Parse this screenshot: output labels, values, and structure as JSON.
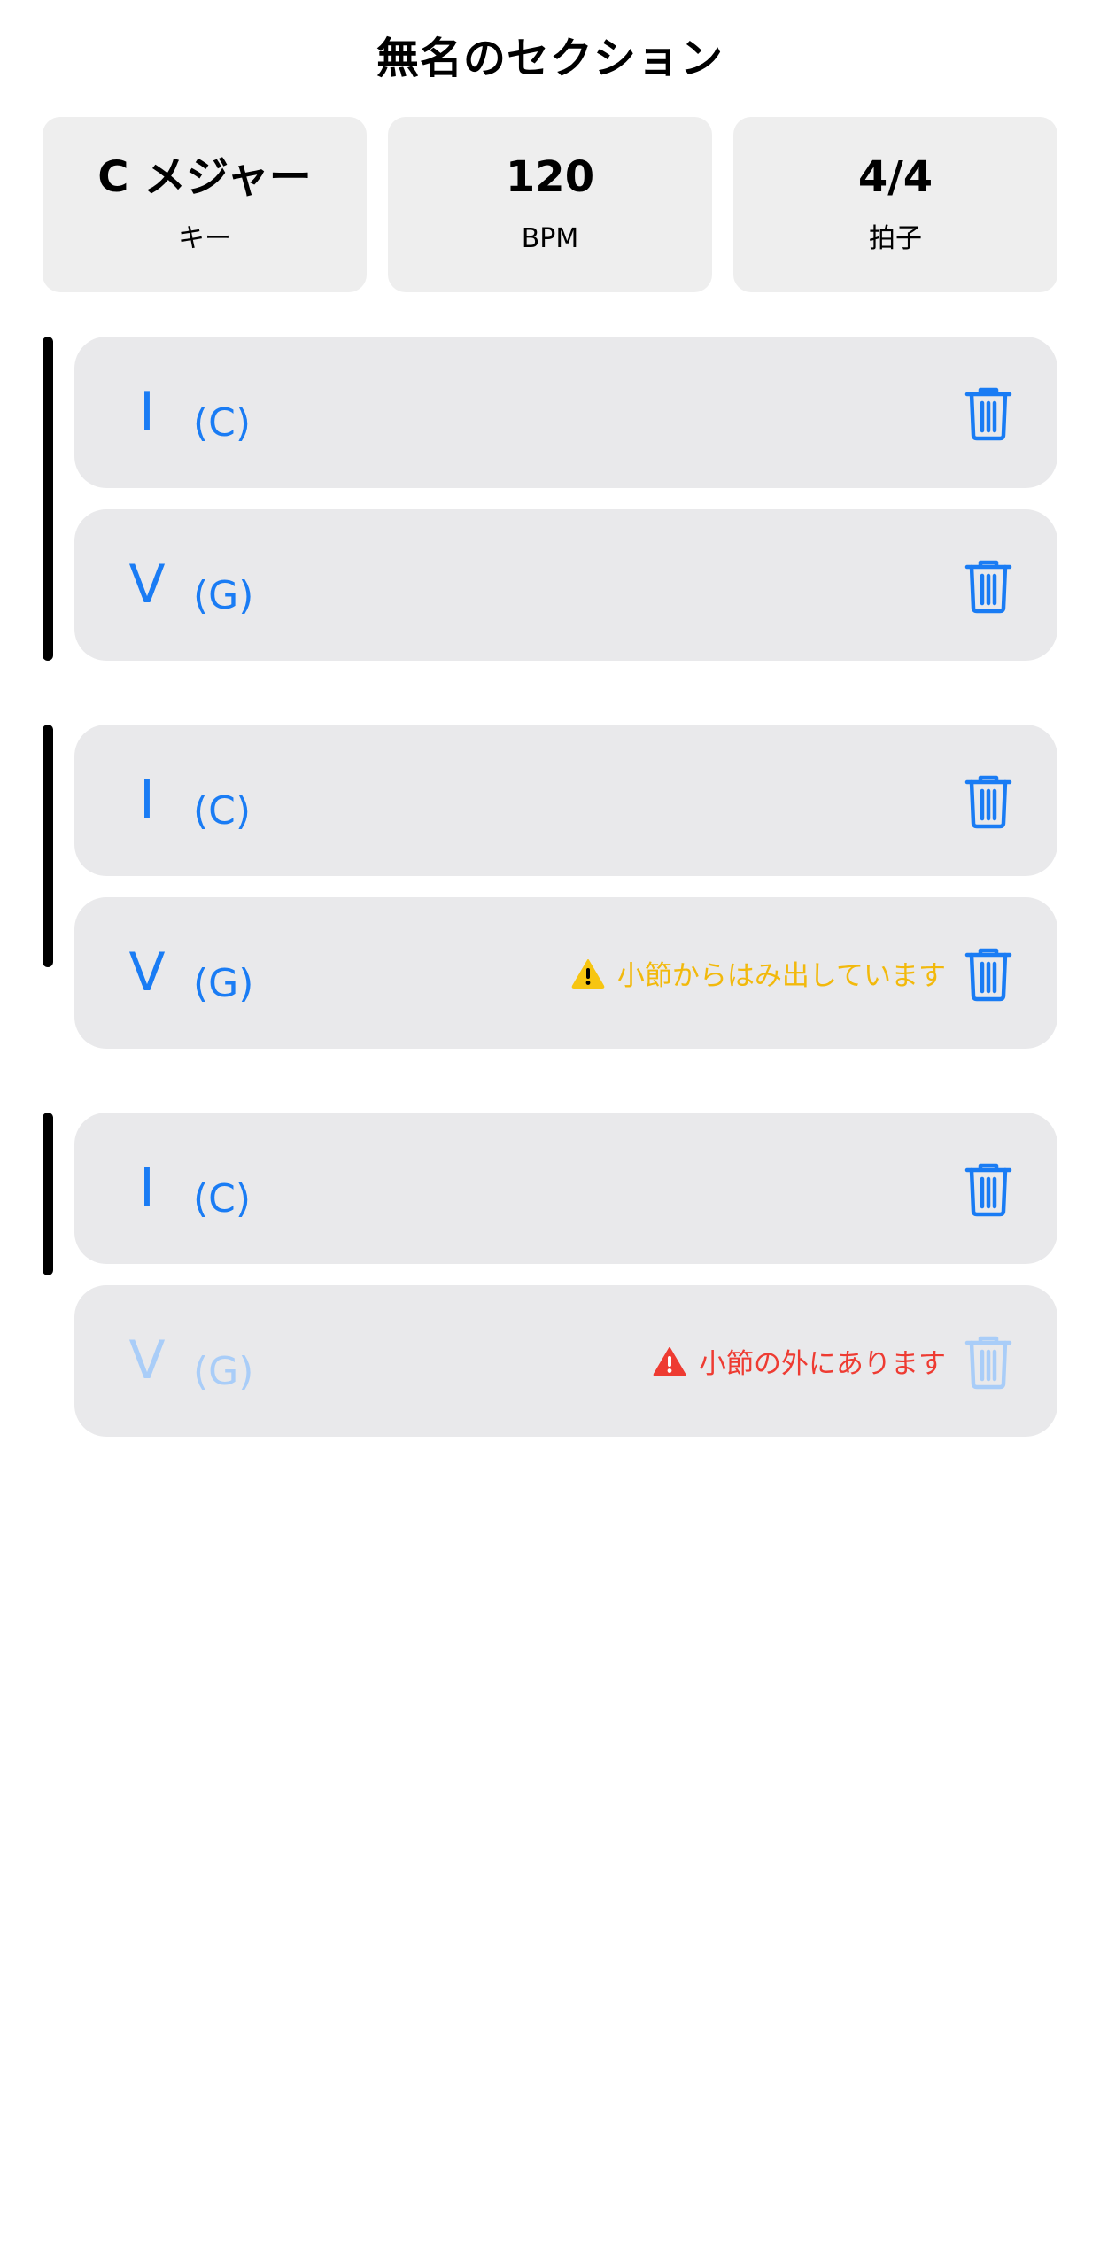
{
  "header": {
    "title": "無名のセクション"
  },
  "info": {
    "key": {
      "value": "C メジャー",
      "label": "キー"
    },
    "bpm": {
      "value": "120",
      "label": "BPM"
    },
    "time": {
      "value": "4/4",
      "label": "拍子"
    }
  },
  "colors": {
    "accent": "#1a7cf4",
    "warning": "#f7c510",
    "error": "#ee3b32",
    "row_bg": "#e9e9eb"
  },
  "measures": [
    {
      "rows": [
        {
          "numeral": "I",
          "chord": "(C)",
          "icon": "trash-icon"
        },
        {
          "numeral": "V",
          "chord": "(G)",
          "icon": "trash-icon"
        }
      ]
    },
    {
      "rows": [
        {
          "numeral": "I",
          "chord": "(C)",
          "icon": "trash-icon"
        },
        {
          "numeral": "V",
          "chord": "(G)",
          "icon": "trash-icon",
          "warning": "小節からはみ出しています",
          "warning_icon": "warning-triangle-icon"
        }
      ]
    },
    {
      "rows": [
        {
          "numeral": "I",
          "chord": "(C)",
          "icon": "trash-icon"
        },
        {
          "numeral": "V",
          "chord": "(G)",
          "icon": "trash-icon",
          "error": "小節の外にあります",
          "error_icon": "error-triangle-icon",
          "disabled": true
        }
      ]
    }
  ]
}
